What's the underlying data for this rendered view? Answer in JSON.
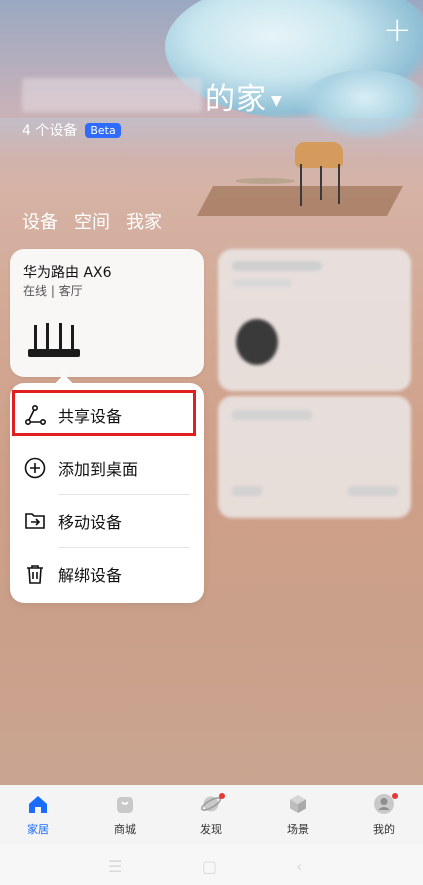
{
  "header": {
    "add_icon": "plus-icon",
    "home_title": "的家",
    "device_count": "4 个设备",
    "beta_badge": "Beta"
  },
  "tabs": [
    {
      "label": "设备"
    },
    {
      "label": "空间"
    },
    {
      "label": "我家"
    }
  ],
  "router_card": {
    "name": "华为路由 AX6",
    "status": "在线 | 客厅"
  },
  "context_menu": {
    "items": [
      {
        "label": "共享设备",
        "icon": "share-icon"
      },
      {
        "label": "添加到桌面",
        "icon": "add-circle-icon"
      },
      {
        "label": "移动设备",
        "icon": "move-folder-icon"
      },
      {
        "label": "解绑设备",
        "icon": "trash-icon"
      }
    ],
    "highlight_color": "#e0201f"
  },
  "bottom_nav": {
    "items": [
      {
        "label": "家居",
        "icon": "home-icon",
        "active": true
      },
      {
        "label": "商城",
        "icon": "shop-bag-icon"
      },
      {
        "label": "发现",
        "icon": "planet-icon"
      },
      {
        "label": "场景",
        "icon": "cube-icon"
      },
      {
        "label": "我的",
        "icon": "user-icon"
      }
    ],
    "accent": "#1a6cff"
  }
}
